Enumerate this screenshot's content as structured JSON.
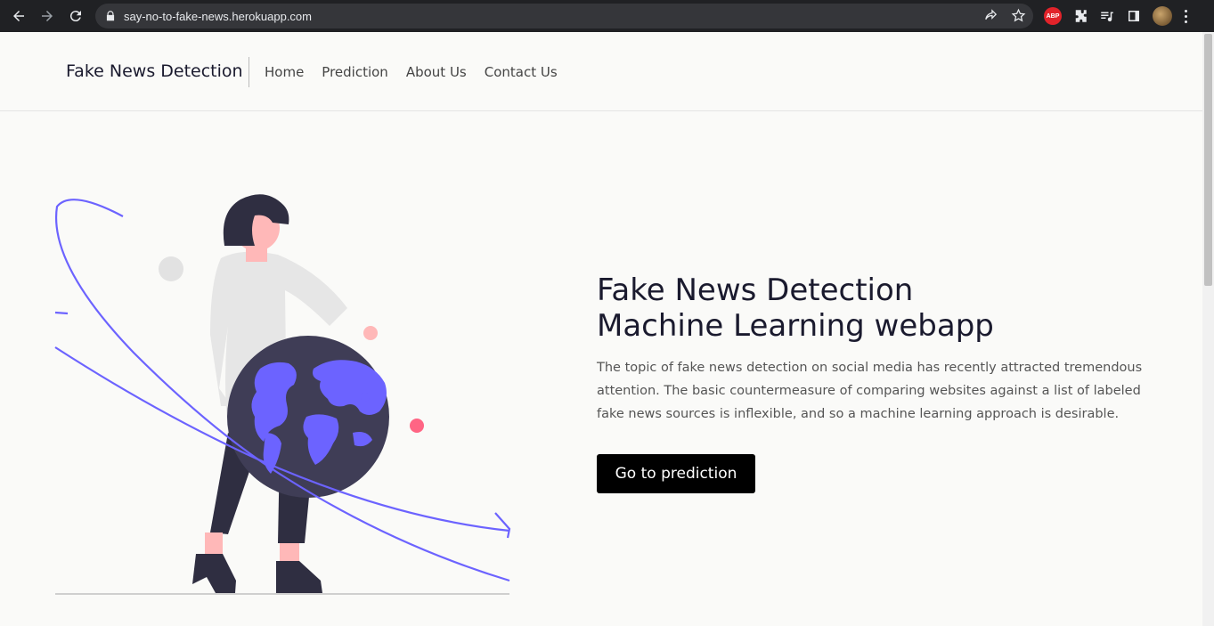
{
  "browser": {
    "url": "say-no-to-fake-news.herokuapp.com",
    "extension_badge": "ABP"
  },
  "navbar": {
    "brand": "Fake News Detection",
    "links": [
      "Home",
      "Prediction",
      "About Us",
      "Contact Us"
    ]
  },
  "hero": {
    "title_line1": "Fake News Detection",
    "title_line2": "Machine Learning webapp",
    "description": "The topic of fake news detection on social media has recently attracted tremendous attention. The basic countermeasure of comparing websites against a list of labeled fake news sources is inflexible, and so a machine learning approach is desirable.",
    "cta_label": "Go to prediction"
  },
  "colors": {
    "accent_purple": "#6c63ff",
    "dark_figure": "#2f2e41",
    "dot_pink": "#ff6584",
    "button_bg": "#000000"
  }
}
